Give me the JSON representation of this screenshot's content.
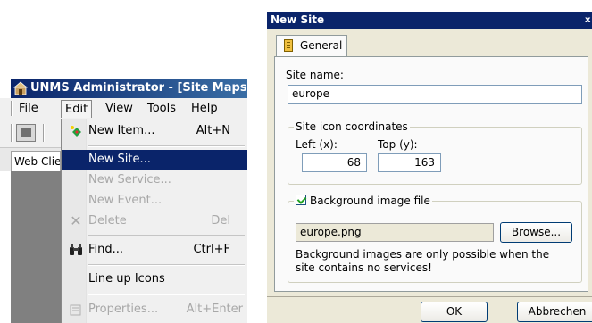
{
  "app": {
    "title": "UNMS Administrator - [Site Maps]",
    "menu": [
      "File",
      "Edit",
      "View",
      "Tools",
      "Help"
    ],
    "active_menu": "Edit",
    "document_tab": "Web Client"
  },
  "edit_menu": {
    "items": [
      {
        "label": "New Item...",
        "shortcut": "Alt+N",
        "icon": "new-item-icon",
        "disabled": false
      },
      {
        "label": "New Site...",
        "shortcut": "",
        "icon": "",
        "disabled": false,
        "selected": true
      },
      {
        "label": "New Service...",
        "shortcut": "",
        "icon": "",
        "disabled": true
      },
      {
        "label": "New Event...",
        "shortcut": "",
        "icon": "",
        "disabled": true
      },
      {
        "label": "Delete",
        "shortcut": "Del",
        "icon": "delete-icon",
        "disabled": true
      },
      {
        "label": "Find...",
        "shortcut": "Ctrl+F",
        "icon": "binoculars-icon",
        "disabled": false
      },
      {
        "label": "Line up Icons",
        "shortcut": "",
        "icon": "",
        "disabled": false
      },
      {
        "label": "Properties...",
        "shortcut": "Alt+Enter",
        "icon": "properties-icon",
        "disabled": true
      }
    ]
  },
  "dialog": {
    "title": "New Site",
    "close_glyph": "x",
    "tab_label": "General",
    "site_name_label": "Site name:",
    "site_name_value": "europe",
    "coords_group_label": "Site icon coordinates",
    "left_label": "Left (x):",
    "left_value": "68",
    "top_label": "Top (y):",
    "top_value": "163",
    "bg_group_label": "Background image file",
    "bg_checked": true,
    "bg_file_value": "europe.png",
    "browse_label": "Browse...",
    "bg_note": "Background images are only possible when the site contains no services!",
    "ok_label": "OK",
    "cancel_label": "Abbrechen"
  },
  "colors": {
    "selection": "#0a246a",
    "dialog_face": "#ece9d8",
    "titlebar": "#0a246a"
  }
}
